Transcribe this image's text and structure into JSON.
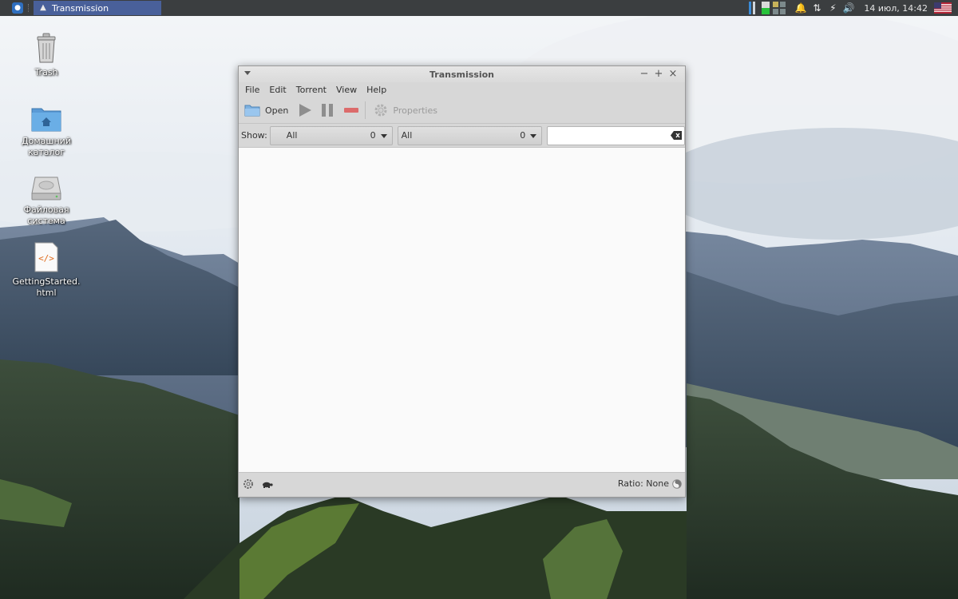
{
  "top_panel": {
    "task": {
      "title": "Transmission",
      "icon": "transmission-icon"
    },
    "clock": "14 июл, 14:42",
    "tray_icons": [
      "notification-bell-icon",
      "network-updown-icon",
      "power-icon",
      "volume-icon"
    ],
    "keyboard_layout_icon": "us-flag-icon",
    "colors": {
      "panel_bg": "#3b3e40",
      "task_active_bg": "#49609a"
    }
  },
  "desktop": {
    "icons": [
      {
        "label": "Trash",
        "icon": "trash-icon"
      },
      {
        "label": "Домашний\nкаталог",
        "icon": "home-folder-icon"
      },
      {
        "label": "Файловая\nсистема",
        "icon": "drive-icon"
      },
      {
        "label": "GettingStarted.\nhtml",
        "icon": "html-file-icon"
      }
    ]
  },
  "window": {
    "title": "Transmission",
    "controls": {
      "minimize": "−",
      "maximize": "+",
      "close": "×"
    },
    "menu": [
      "File",
      "Edit",
      "Torrent",
      "View",
      "Help"
    ],
    "toolbar": {
      "open_label": "Open",
      "properties_label": "Properties",
      "icons": [
        "open-folder-icon",
        "start-icon",
        "pause-icon",
        "remove-icon",
        "properties-gear-icon"
      ]
    },
    "filter": {
      "show_label": "Show:",
      "activity": {
        "value": "All",
        "count": "0"
      },
      "tracker": {
        "value": "All",
        "count": "0"
      },
      "search": {
        "value": ""
      }
    },
    "status": {
      "ratio_label": "Ratio: None",
      "icons": [
        "settings-gear-icon",
        "turtle-icon",
        "ratio-icon"
      ]
    }
  }
}
